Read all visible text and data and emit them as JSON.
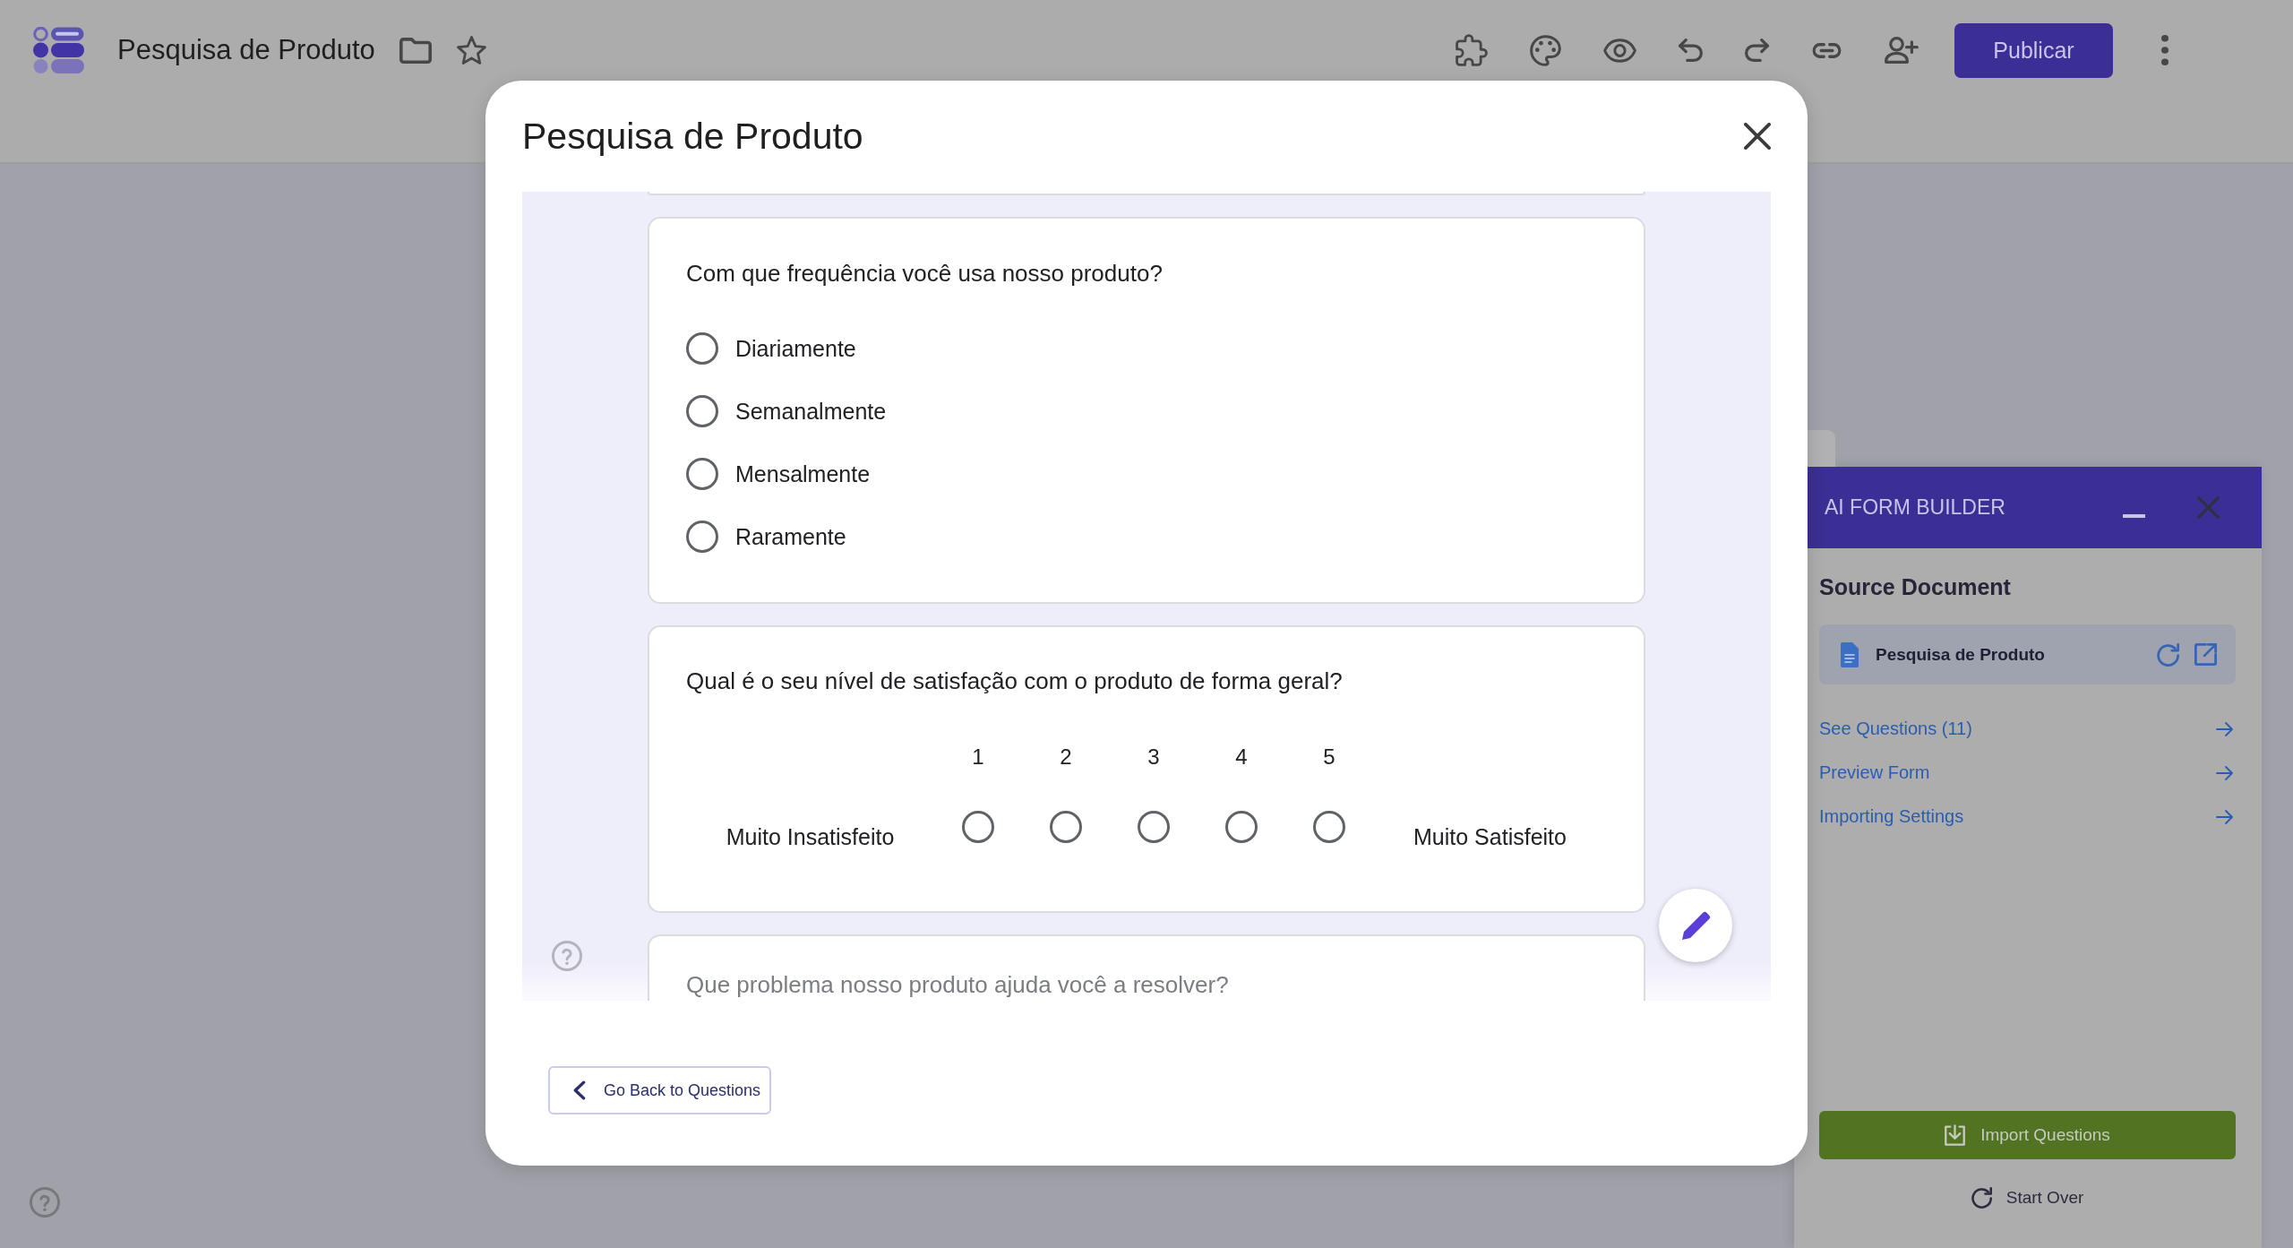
{
  "app_bar": {
    "title": "Pesquisa de Produto",
    "publish_button": "Publicar"
  },
  "dialog": {
    "title": "Pesquisa de Produto",
    "questions": [
      {
        "kind": "choice",
        "text": "Com que frequência você usa nosso produto?",
        "options": [
          {
            "label": "Diariamente",
            "selected": false
          },
          {
            "label": "Semanalmente",
            "selected": false
          },
          {
            "label": "Mensalmente",
            "selected": false
          },
          {
            "label": "Raramente",
            "selected": false
          }
        ]
      },
      {
        "kind": "scale",
        "text": "Qual é o seu nível de satisfação com o produto de forma geral?",
        "low_label": "Muito Insatisfeito",
        "high_label": "Muito Satisfeito",
        "points": [
          {
            "label": "1",
            "selected": false
          },
          {
            "label": "2",
            "selected": false
          },
          {
            "label": "3",
            "selected": false
          },
          {
            "label": "4",
            "selected": false
          },
          {
            "label": "5",
            "selected": false
          }
        ]
      },
      {
        "kind": "paragraph",
        "text": "Que problema nosso produto ajuda você a resolver?"
      }
    ],
    "back_button": "Go Back to Questions"
  },
  "side_panel": {
    "title": "AI FORM BUILDER",
    "section_title": "Source Document",
    "document": "Pesquisa de Produto",
    "links": [
      "See Questions (11)",
      "Preview Form",
      "Importing Settings"
    ],
    "import_button": "Import Questions",
    "start_over_button": "Start Over"
  }
}
